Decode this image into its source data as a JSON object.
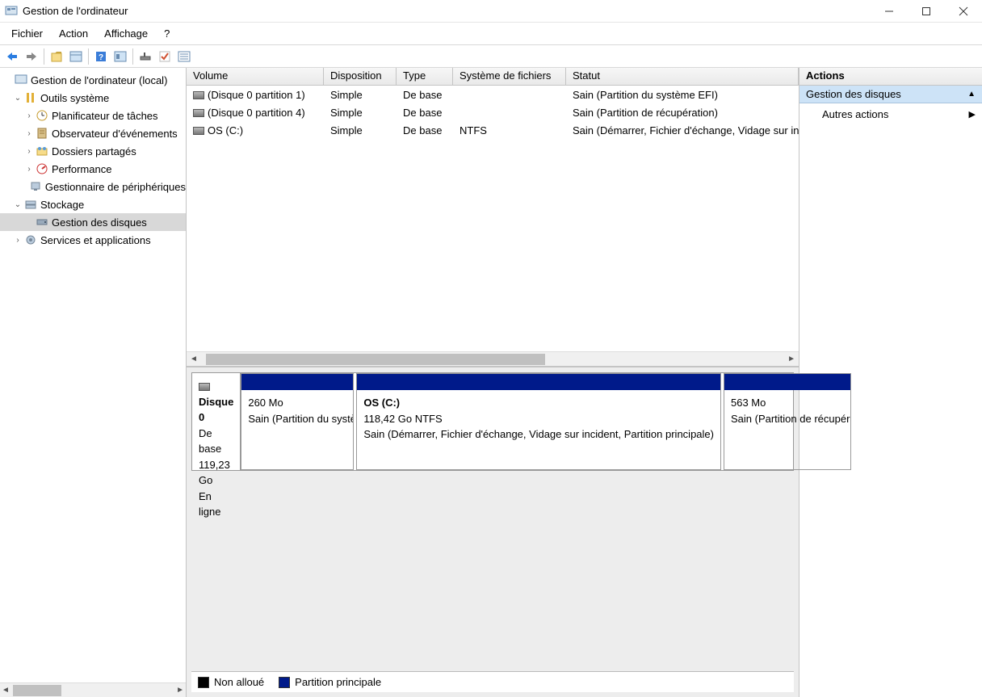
{
  "window": {
    "title": "Gestion de l'ordinateur"
  },
  "menubar": {
    "file": "Fichier",
    "action": "Action",
    "view": "Affichage",
    "help": "?"
  },
  "tree": {
    "root": "Gestion de l'ordinateur (local)",
    "system_tools": "Outils système",
    "task_scheduler": "Planificateur de tâches",
    "event_viewer": "Observateur d'événements",
    "shared_folders": "Dossiers partagés",
    "performance": "Performance",
    "device_manager": "Gestionnaire de périphériques",
    "storage": "Stockage",
    "disk_management": "Gestion des disques",
    "services_apps": "Services et applications"
  },
  "volumes": {
    "headers": {
      "volume": "Volume",
      "layout": "Disposition",
      "type": "Type",
      "fs": "Système de fichiers",
      "status": "Statut"
    },
    "rows": [
      {
        "volume": "(Disque 0 partition 1)",
        "layout": "Simple",
        "type": "De base",
        "fs": "",
        "status": "Sain (Partition du système EFI)"
      },
      {
        "volume": "(Disque 0 partition 4)",
        "layout": "Simple",
        "type": "De base",
        "fs": "",
        "status": "Sain (Partition de récupération)"
      },
      {
        "volume": "OS (C:)",
        "layout": "Simple",
        "type": "De base",
        "fs": "NTFS",
        "status": "Sain (Démarrer, Fichier d'échange, Vidage sur incident, Partition principale)"
      }
    ]
  },
  "disk": {
    "name": "Disque 0",
    "type": "De base",
    "size": "119,23 Go",
    "state": "En ligne",
    "partitions": [
      {
        "name": "",
        "size": "260 Mo",
        "status": "Sain (Partition du système EFI)"
      },
      {
        "name": "OS  (C:)",
        "size": "118,42 Go NTFS",
        "status": "Sain (Démarrer, Fichier d'échange, Vidage sur incident, Partition principale)"
      },
      {
        "name": "",
        "size": "563 Mo",
        "status": "Sain (Partition de récupération)"
      }
    ]
  },
  "legend": {
    "unallocated": "Non alloué",
    "primary": "Partition principale"
  },
  "actions": {
    "header": "Actions",
    "section": "Gestion des disques",
    "more": "Autres actions"
  }
}
